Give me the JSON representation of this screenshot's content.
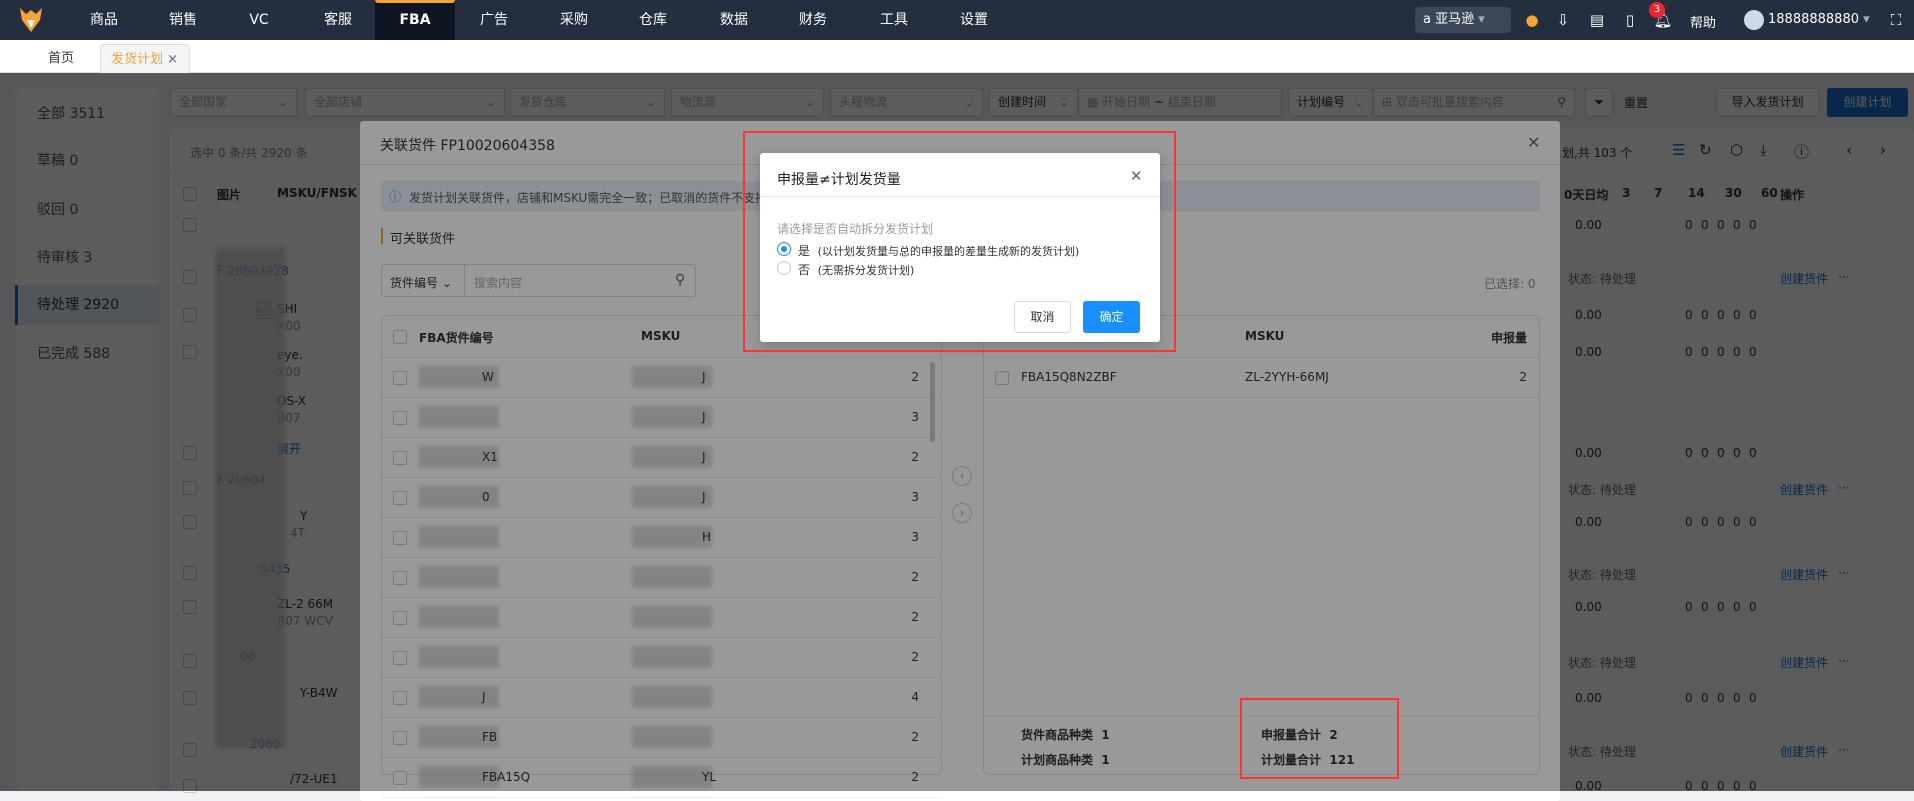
{
  "nav": {
    "items": [
      "商品",
      "销售",
      "VC",
      "客服",
      "FBA",
      "广告",
      "采购",
      "仓库",
      "数据",
      "财务",
      "工具",
      "设置"
    ],
    "active": "FBA",
    "platform": "亚马逊",
    "notifications": "3",
    "help": "帮助",
    "user": "18888888880"
  },
  "tabs": {
    "home": "首页",
    "current": "发货计划",
    "close": "×"
  },
  "sidebar": [
    {
      "label": "全部",
      "count": "3511"
    },
    {
      "label": "草稿",
      "count": "0"
    },
    {
      "label": "驳回",
      "count": "0"
    },
    {
      "label": "待审核",
      "count": "3"
    },
    {
      "label": "待处理",
      "count": "2920"
    },
    {
      "label": "已完成",
      "count": "588"
    }
  ],
  "filters": {
    "country": "全部国家",
    "shop": "全部店铺",
    "warehouse": "发货仓库",
    "carrier": "物流商",
    "first_leg": "头程物流",
    "date_type": "创建时间",
    "start_date": "开始日期",
    "tilde": "~",
    "end_date": "结束日期",
    "search_field": "计划编号",
    "search_placeholder": "双击可批量搜索内容",
    "reset": "重置",
    "import": "导入发货计划",
    "create": "创建计划"
  },
  "background": {
    "selection": "选中 0 条/共 2920 条",
    "plan_total": "划,共 103 个",
    "col_image": "图片",
    "col_msku": "MSKU/FNSK",
    "col_avg": "0天日均",
    "cols": [
      "3",
      "7",
      "14",
      "30",
      "60"
    ],
    "col_ops": "操作",
    "avg": "0.00",
    "zero": "0",
    "status": "状态: 待处理",
    "create_shipment": "创建货件",
    "more": "···",
    "fragments": {
      "plan1": "20603928",
      "sku1": "SHI",
      "fn1": "X00",
      "sku2": "eye.",
      "fn2": "X00",
      "sku3": "OS-X",
      "fn3": "B07",
      "expand": "展开",
      "plan2": "20604",
      "sku4": "Y",
      "fn4": "4T",
      "plan3": "0435",
      "sku5": "ZL-2",
      "sku5b": "66M",
      "fn5": "B07",
      "fn5b": "WCV",
      "plan4": "00",
      "sku6": "Y-B4W",
      "plan5": "2060",
      "sku7": "/72-UE1",
      "tag": "加"
    }
  },
  "link_dialog": {
    "title": "关联货件 FP10020604358",
    "info": "发货计划关联货件，店铺和MSKU需完全一致；已取消的货件不支持",
    "section": "可关联货件",
    "search_field": "货件编号",
    "search_placeholder": "搜索内容",
    "selected_label": "已选择: 0",
    "left_table": {
      "headers": [
        "FBA货件编号",
        "MSKU",
        ""
      ],
      "rows": [
        {
          "fba": "W",
          "msku": "J",
          "qty": "2"
        },
        {
          "fba": "",
          "msku": "J",
          "qty": "3"
        },
        {
          "fba": "X1",
          "msku": "J",
          "qty": "2"
        },
        {
          "fba": "0",
          "msku": "J",
          "qty": "3"
        },
        {
          "fba": "",
          "msku": "H",
          "qty": "3"
        },
        {
          "fba": "",
          "msku": "",
          "qty": "2"
        },
        {
          "fba": "",
          "msku": "",
          "qty": "2"
        },
        {
          "fba": "",
          "msku": "",
          "qty": "2"
        },
        {
          "fba": "J",
          "msku": "",
          "qty": "4"
        },
        {
          "fba": "FB",
          "msku": "",
          "qty": "2"
        },
        {
          "fba": "FBA15Q",
          "msku": "YL",
          "qty": "2"
        }
      ]
    },
    "right_table": {
      "headers": [
        "FBA货件编号",
        "MSKU",
        "申报量"
      ],
      "rows": [
        {
          "fba": "FBA15Q8N2ZBF",
          "msku": "ZL-2YYH-66MJ",
          "qty": "2"
        }
      ]
    },
    "summary": {
      "shipment_kinds_label": "货件商品种类",
      "shipment_kinds": "1",
      "plan_kinds_label": "计划商品种类",
      "plan_kinds": "1",
      "declared_total_label": "申报量合计",
      "declared_total": "2",
      "plan_total_label": "计划量合计",
      "plan_total": "121"
    }
  },
  "confirm_modal": {
    "title": "申报量≠计划发货量",
    "hint": "请选择是否自动拆分发货计划",
    "options": [
      {
        "label": "是",
        "desc": "(以计划发货量与总的申报量的差量生成新的发货计划)",
        "selected": true
      },
      {
        "label": "否",
        "desc": "(无需拆分发货计划)",
        "selected": false
      }
    ],
    "cancel": "取消",
    "ok": "确定"
  },
  "colors": {
    "nav_bg": "#232f3e",
    "accent": "#f7a234",
    "primary": "#1890ff",
    "highlight": "#ff3333"
  }
}
